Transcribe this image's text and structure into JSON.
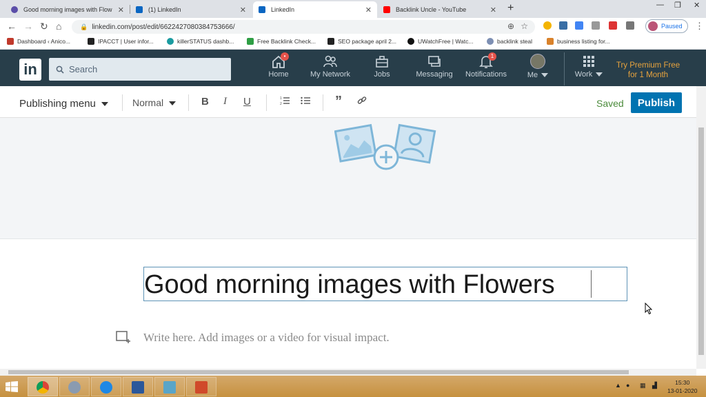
{
  "browser": {
    "tabs": [
      {
        "title": "Good morning images with Flow",
        "favicon_color": "#5b4ea8"
      },
      {
        "title": "(1) LinkedIn",
        "favicon_color": "#0a66c2"
      },
      {
        "title": "LinkedIn",
        "favicon_color": "#0a66c2"
      },
      {
        "title": "Backlink Uncle - YouTube",
        "favicon_color": "#ff0000"
      }
    ],
    "url": "linkedin.com/post/edit/6622427080384753666/",
    "profile_status": "Paused",
    "bookmarks": [
      {
        "label": "Dashboard ‹ Anico...",
        "color": "#c0392b"
      },
      {
        "label": "IPACCT | User infor...",
        "color": "#222222"
      },
      {
        "label": "killerSTATUS dashb...",
        "color": "#1a9ba0"
      },
      {
        "label": "Free Backlink Check...",
        "color": "#2e9e44"
      },
      {
        "label": "SEO package april 2...",
        "color": "#222222"
      },
      {
        "label": "UWatchFree | Watc...",
        "color": "#111111"
      },
      {
        "label": "backlink steal",
        "color": "#7d8fb3"
      },
      {
        "label": "business listing for...",
        "color": "#d9822b"
      }
    ]
  },
  "linkedin_nav": {
    "logo": "in",
    "search_placeholder": "Search",
    "items": [
      {
        "label": "Home",
        "icon": "home-icon",
        "badge": "•"
      },
      {
        "label": "My Network",
        "icon": "network-icon"
      },
      {
        "label": "Jobs",
        "icon": "briefcase-icon"
      },
      {
        "label": "Messaging",
        "icon": "messaging-icon"
      },
      {
        "label": "Notifications",
        "icon": "bell-icon",
        "badge": "1"
      },
      {
        "label": "Me",
        "icon": "avatar"
      },
      {
        "label": "Work",
        "icon": "grid-icon"
      }
    ],
    "premium_line1": "Try Premium Free",
    "premium_line2": "for 1 Month"
  },
  "editor": {
    "publishing_menu": "Publishing menu",
    "text_style": "Normal",
    "tools": [
      "B",
      "I",
      "U"
    ],
    "saved_status": "Saved",
    "publish_button": "Publish",
    "title": "Good morning images with Flowers",
    "body_placeholder": "Write here. Add images or a video for visual impact."
  },
  "taskbar": {
    "time": "15:30",
    "date": "13-01-2020"
  },
  "colors": {
    "linkedin_nav": "#283e4a",
    "publish_blue": "#0073b1",
    "premium_gold": "#e7a33e",
    "saved_green": "#4b8b3b"
  }
}
